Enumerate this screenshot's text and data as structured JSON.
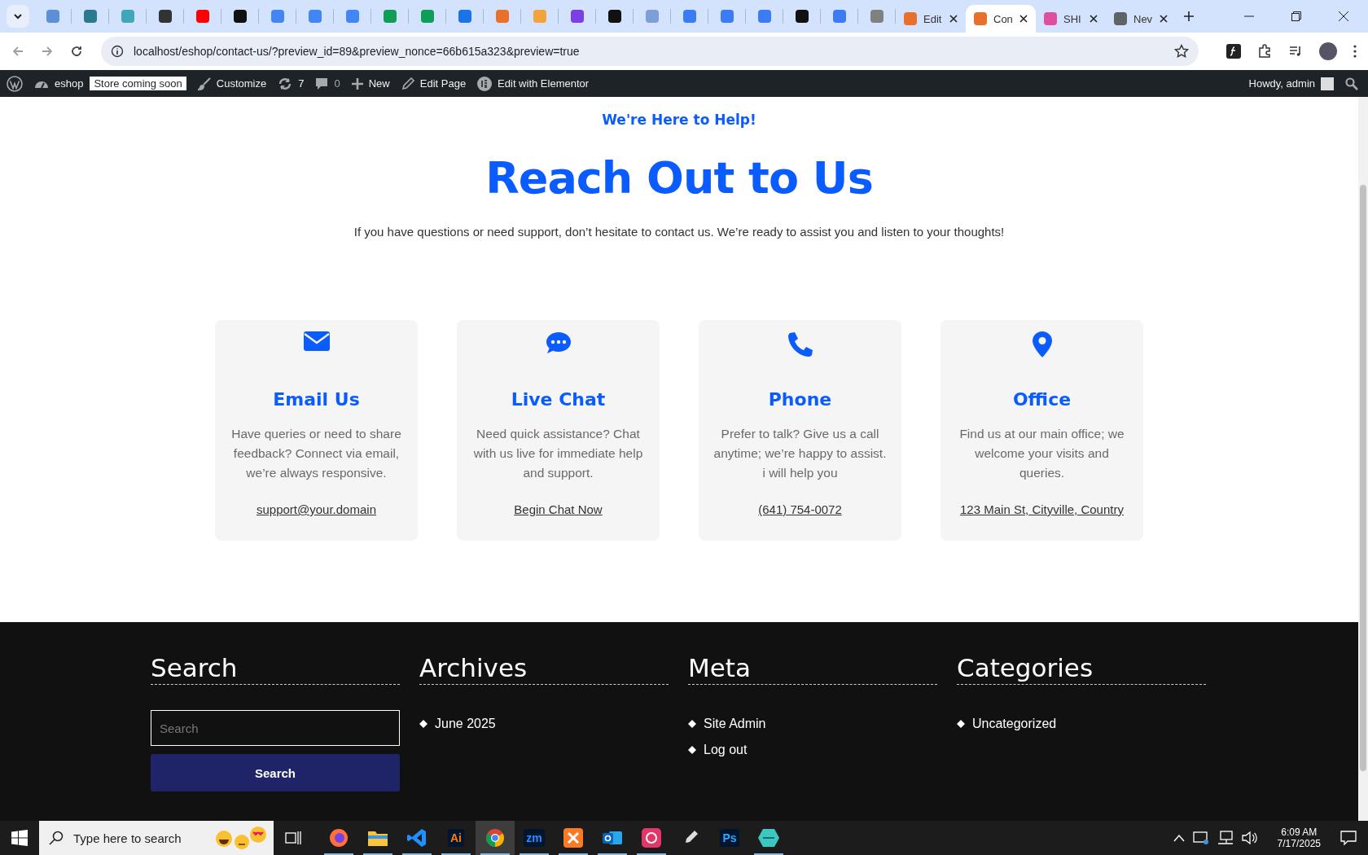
{
  "browser": {
    "pinned_tabs": [
      {
        "color": "#5b8fd6"
      },
      {
        "color": "#2a7a8c"
      },
      {
        "color": "#3fa7b8"
      },
      {
        "color": "#333333"
      },
      {
        "color": "#ff0000"
      },
      {
        "color": "#111111"
      },
      {
        "color": "#4285f4"
      },
      {
        "color": "#4285f4"
      },
      {
        "color": "#4285f4"
      },
      {
        "color": "#0f9d58"
      },
      {
        "color": "#0f9d58"
      },
      {
        "color": "#1a73e8"
      },
      {
        "color": "#e8702a"
      },
      {
        "color": "#f2a33a"
      },
      {
        "color": "#7b3fe4"
      },
      {
        "color": "#111111"
      },
      {
        "color": "#7c9fd8"
      },
      {
        "color": "#3b7cf5"
      },
      {
        "color": "#3b7cf5"
      },
      {
        "color": "#3b7cf5"
      },
      {
        "color": "#111111"
      },
      {
        "color": "#3b7cf5"
      },
      {
        "color": "#808080"
      }
    ],
    "tabs": [
      {
        "title": "Edit",
        "color": "#e8702a",
        "selected": false
      },
      {
        "title": "Con",
        "color": "#e8702a",
        "selected": true
      },
      {
        "title": "SHI",
        "color": "#e04ea0",
        "selected": false
      },
      {
        "title": "Nev",
        "color": "#5f6368",
        "selected": false
      }
    ],
    "address": "localhost/eshop/contact-us/?preview_id=89&preview_nonce=66b615a323&preview=true"
  },
  "admin_bar": {
    "site": "eshop",
    "badge": "Store coming soon",
    "customize": "Customize",
    "updates": "7",
    "comments": "0",
    "new": "New",
    "edit_page": "Edit Page",
    "elementor": "Edit with Elementor",
    "greeting": "Howdy, admin"
  },
  "hero": {
    "eyebrow": "We're Here to Help!",
    "heading": "Reach Out to Us",
    "intro": "If you have questions or need support, don’t hesitate to contact us. We’re ready to assist you and listen to your thoughts!"
  },
  "cards": [
    {
      "kind": "email",
      "title": "Email Us",
      "text": "Have queries or need to share feedback? Connect via email, we’re always responsive.",
      "link": "support@your.domain"
    },
    {
      "kind": "chat",
      "title": "Live Chat",
      "text": "Need quick assistance? Chat with us live for immediate help and support.",
      "link": "Begin Chat Now"
    },
    {
      "kind": "phone",
      "title": "Phone",
      "text": "Prefer to talk? Give us a call anytime; we’re happy to assist. i will help you",
      "link": "(641) 754-0072"
    },
    {
      "kind": "office",
      "title": "Office",
      "text": "Find us at our main office; we welcome your visits and queries.",
      "link": "123 Main St, Cityville, Country"
    }
  ],
  "footer": [
    {
      "kind": "search",
      "title": "Search",
      "placeholder": "Search",
      "button": "Search"
    },
    {
      "kind": "list",
      "title": "Archives",
      "items": [
        "June 2025"
      ]
    },
    {
      "kind": "list",
      "title": "Meta",
      "items": [
        "Site Admin",
        "Log out"
      ]
    },
    {
      "kind": "list",
      "title": "Categories",
      "items": [
        "Uncategorized"
      ]
    }
  ],
  "taskbar": {
    "search_placeholder": "Type here to search",
    "apps": [
      {
        "kind": "firefox",
        "open": true,
        "selected": false
      },
      {
        "kind": "folder",
        "open": true,
        "selected": false
      },
      {
        "kind": "code",
        "open": true,
        "selected": false
      },
      {
        "kind": "label",
        "label": "Ai",
        "color": "#ff7c00",
        "open": true,
        "selected": false
      },
      {
        "kind": "chrome",
        "open": true,
        "selected": true
      },
      {
        "kind": "label",
        "label": "zm",
        "color": "#2d8cff",
        "open": true,
        "selected": false
      },
      {
        "kind": "xampp",
        "open": true,
        "selected": false
      },
      {
        "kind": "outlook",
        "open": true,
        "selected": false
      },
      {
        "kind": "cloud",
        "open": true,
        "selected": false
      },
      {
        "kind": "pen",
        "open": false,
        "selected": false
      },
      {
        "kind": "label",
        "label": "Ps",
        "color": "#31a8ff",
        "open": false,
        "selected": false
      },
      {
        "kind": "gem",
        "open": true,
        "selected": false
      }
    ],
    "time": "6:09 AM",
    "date": "7/17/2025"
  }
}
